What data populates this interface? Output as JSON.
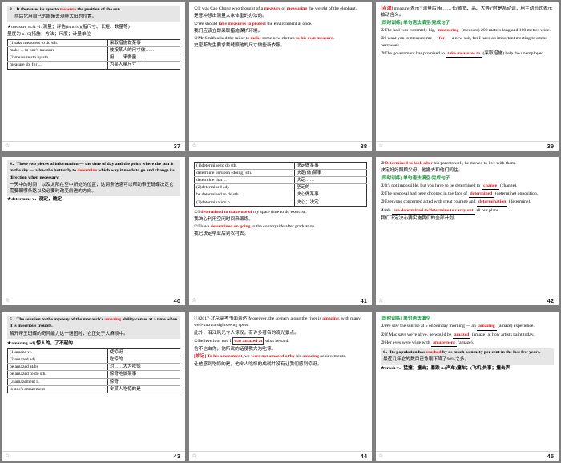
{
  "slides": [
    {
      "page": "37",
      "lines": [
        "3．It then uses its eyes to measure the position of the sun.",
        "然后它用自己的眼睛去测量太阳的位置。",
        "★measure vt.& vi. 测量；评估(in.n./s.)(指尺寸、长短、数量等)",
        "量度为 n.[C]措施；方法；尺度；计量单位"
      ],
      "table": [
        [
          "(1)take measures to do sth.",
          "采取措施做某事"
        ],
        [
          "make ... to one's measure",
          "彼按某人的尺寸做……"
        ],
        [
          "(2)measure sth.by sth.",
          "用……来衡量……"
        ],
        [
          "measure sb. for ...",
          "为某人量尺寸"
        ]
      ]
    },
    {
      "page": "38",
      "lines": [
        "①It was Cao Chong who thought of a measure of measuring the weight of the elephant.",
        "是曹冲想出测量大象体重的办法的。",
        "②We should take measures to protect the environment at once.",
        "我们应该立即采取措施保护环境。",
        "③Mr Smith asked the tailor to make some new clothes to his own measure.",
        "史密斯先生要求裁缝照他的尺寸做些新衣服。"
      ]
    },
    {
      "page": "39",
      "lines": [
        "[点津] measure 表示\"(测量后)有……长(或宽、高、大等)\"时是系动词，用主动形式表示被动含义。",
        "[即时训练] 单句语法填空/完成句子",
        "①The hall was extremely big, measuring (measure) 200 metres long and 100 metres wide.",
        "②I want you to measure me for a new suit, for I have an important meeting to attend next week.",
        "③The government has promised to take measures to (采取措施) help the unemployed."
      ],
      "answers": [
        "measuring",
        "for",
        "take measures to"
      ]
    },
    {
      "page": "40",
      "lines": [
        "4．These two pieces of information — the time of day and the point where the sun is in the sky — allow the butterfly to determine which way it needs to go and change its direction when necessary.",
        "一天中的时间，以及太阳在空中所处的位置，这两条信息可以帮助帝王斑蝶决定它需要朝哪条路以及必要时改变前进的方向。",
        "★determine v．测定，确定"
      ]
    },
    {
      "page": "41",
      "table": [
        [
          "(1)determine to do sth.",
          "决定做某事"
        ],
        [
          "determine on/upon (doing) sth.",
          "决定(做)某事"
        ],
        [
          "determine that ...",
          "决定……"
        ],
        [
          "(2)determined adj.",
          "坚定的"
        ],
        [
          "be determined to do sth.",
          "决心做某事"
        ],
        [
          "(3)determination n.",
          "决心；决定"
        ]
      ],
      "lines": [
        "①I determined to make use of my spare time to do exercise.",
        "我决心利用空闲时间来锻炼。",
        "②I have determined on going to the countryside after graduation.",
        "我已决定毕业后到农村去。"
      ]
    },
    {
      "page": "42",
      "lines": [
        "③Determined to look after his parents well, he moved to live with them.",
        "决定好好照顾父母，他搬去和他们同住。",
        "[即时训练] 单句语法填空/完成句子",
        "①It's not impossible, but you have to be determined to change (change).",
        "②The proposal had been dropped in the face of determined (determine) opposition.",
        "③Everyone concerned acted with great courage and determination (determine).",
        "④We are determined to/determine to carry out all our plans.",
        "我们下定决心要实施我们的全部计划。"
      ],
      "answers": [
        "change",
        "determined",
        "determination",
        "are determined to/determine to carry out"
      ]
    },
    {
      "page": "43",
      "lines": [
        "5．The solution to the mystery of the monarch's amazing ability comes at a time when it is in serious trouble.",
        "解开帝王斑蝶的奇异能力这一谜团时，它正处于大麻烦中。",
        "★amazing adj.惊人的，了不起的"
      ],
      "table": [
        [
          "(1)amaze vt.",
          "使惊讶"
        ],
        [
          "(2)amazed adj.",
          "吃惊的"
        ],
        [
          "be amazed at/by",
          "对……大为吃惊"
        ],
        [
          "be amazed to do sth.",
          "惊奇地做某事"
        ],
        [
          "(3)amazement n.",
          "惊奇"
        ],
        [
          "to one's amazement",
          "令某人吃惊的是"
        ]
      ]
    },
    {
      "page": "44",
      "lines": [
        "①(2017·北京高考书面表达)Moreover, the scenery along the river is amazing, with many well-known sightseeing spots.",
        "此外，沿江风光令人惊叹，有许多著名的观光景点。",
        "②Believe it or not, I was amazed at what he said.",
        "信不信由你，他所说的话使我大为吃惊。",
        "[妙记] To his amazement, we were not amazed at/by his amazing achievements.",
        "让他感到吃惊的是，他令人吃惊的成就并没有让我们感到惊讶。"
      ]
    },
    {
      "page": "45",
      "lines": [
        "[即时训练] 单句语法填空",
        "①We saw the sunrise at 5 on Sunday morning — an amazing (amaze) experience.",
        "②If Mac says we're alive, he would be amazed (amaze) at how artists paint today.",
        "③Her eyes were wide with amazement (amaze).",
        "6．Its population has crashed by as much as ninety per cent in the last few years.",
        "最近几年它的数目已急剧下降了90%之多。",
        "★crash v．猛撞；撞击；暴跌 n.(汽车)撞车；(飞机)失事；撞击声"
      ],
      "answers": [
        "amazing",
        "amazed",
        "amazement"
      ]
    }
  ]
}
